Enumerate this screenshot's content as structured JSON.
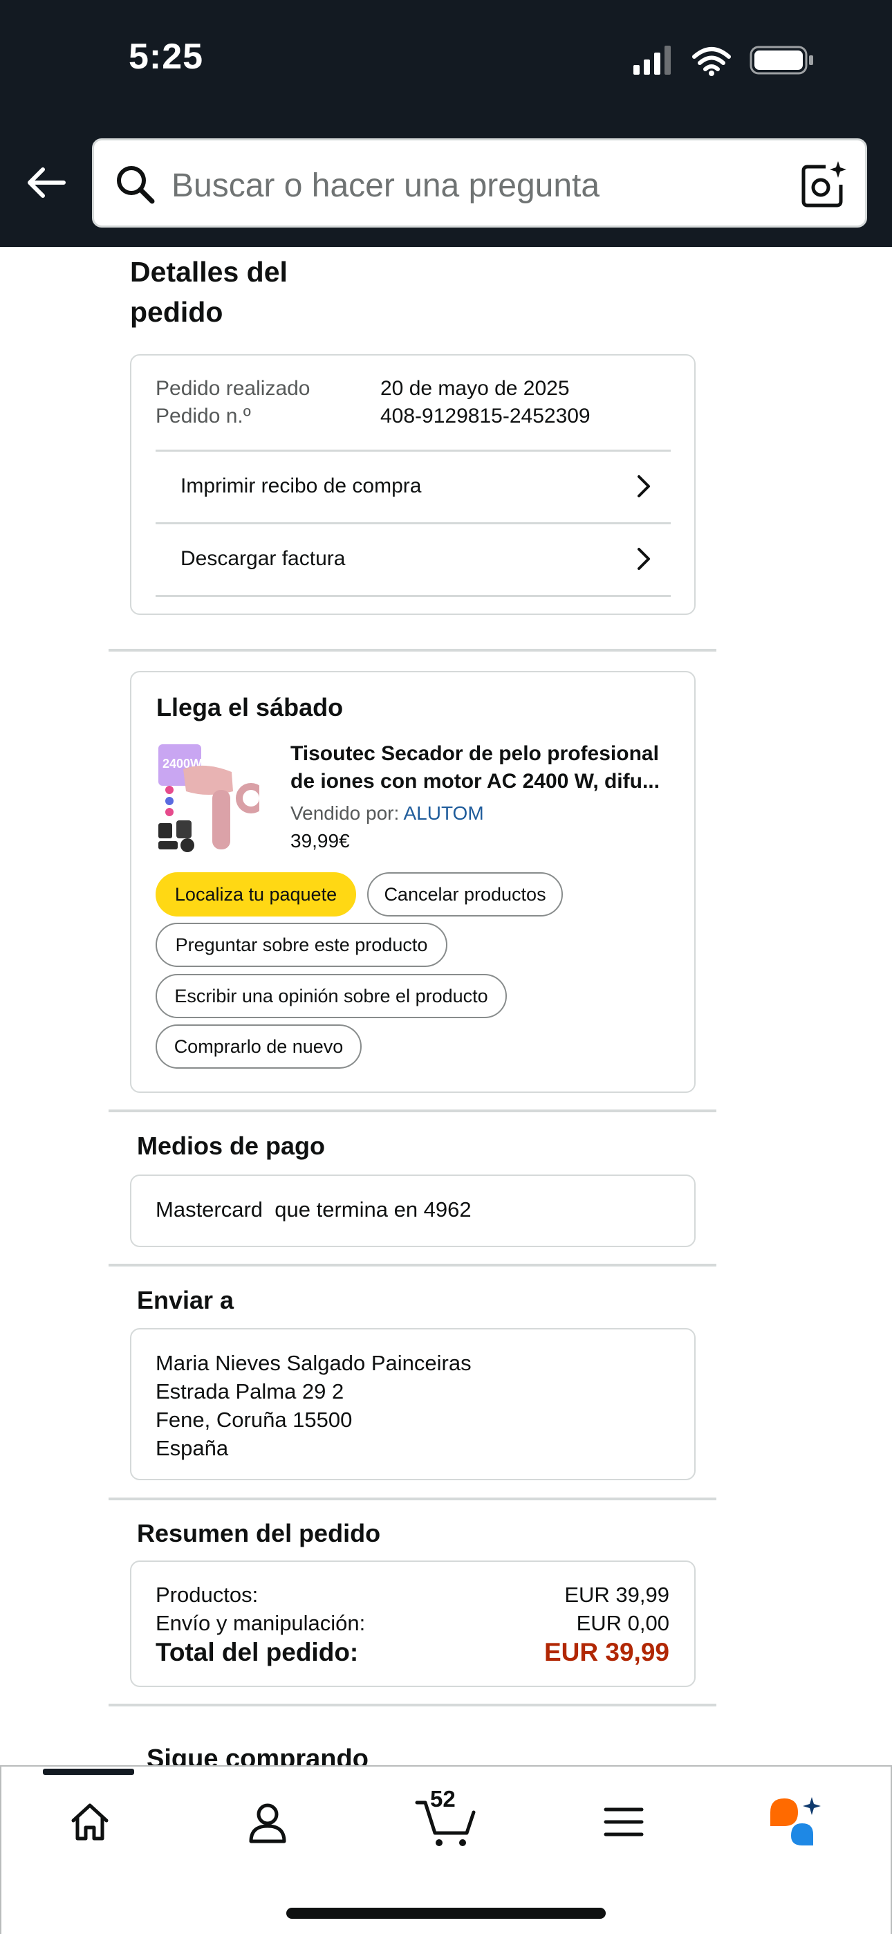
{
  "status_bar": {
    "time": "5:25"
  },
  "header": {
    "search_placeholder": "Buscar o hacer una pregunta"
  },
  "page_title": "Detalles del pedido",
  "order_info": {
    "placed_label": "Pedido realizado",
    "placed_value": "20 de mayo de 2025",
    "number_label": "Pedido n.º",
    "number_value": "408-9129815-2452309",
    "links": [
      "Imprimir recibo de compra",
      "Descargar factura"
    ]
  },
  "shipment": {
    "heading": "Llega el sábado",
    "product_title": "Tisoutec Secador de pelo profesional de iones con motor AC 2400 W, difu...",
    "seller_prefix": "Vendido por: ",
    "seller_name": "ALUTOM",
    "price": "39,99€",
    "actions": {
      "track": "Localiza tu paquete",
      "cancel": "Cancelar productos",
      "ask": "Preguntar sobre este producto",
      "review": "Escribir una opinión sobre el producto",
      "buy_again": "Comprarlo de nuevo"
    }
  },
  "payment": {
    "heading": "Medios de pago",
    "method": "Mastercard  que termina en 4962"
  },
  "ship_to": {
    "heading": "Enviar a",
    "lines": [
      "Maria Nieves Salgado Painceiras",
      "Estrada Palma 29 2",
      "Fene, Coruña 15500",
      "España"
    ]
  },
  "summary": {
    "heading": "Resumen del pedido",
    "products_label": "Productos:",
    "products_value": "EUR 39,99",
    "shipping_label": "Envío y manipulación:",
    "shipping_value": "EUR 0,00",
    "total_label": "Total del pedido:",
    "total_value": "EUR 39,99"
  },
  "peek_heading": "Sigue comprando",
  "bottom_nav": {
    "cart_count": "52",
    "items": [
      "home-icon",
      "account-icon",
      "cart-icon",
      "menu-icon",
      "rufus-icon"
    ]
  },
  "colors": {
    "header_bg": "#131a22",
    "primary_button": "#ffd814",
    "link": "#1f5c9b",
    "total_price": "#b12704"
  }
}
